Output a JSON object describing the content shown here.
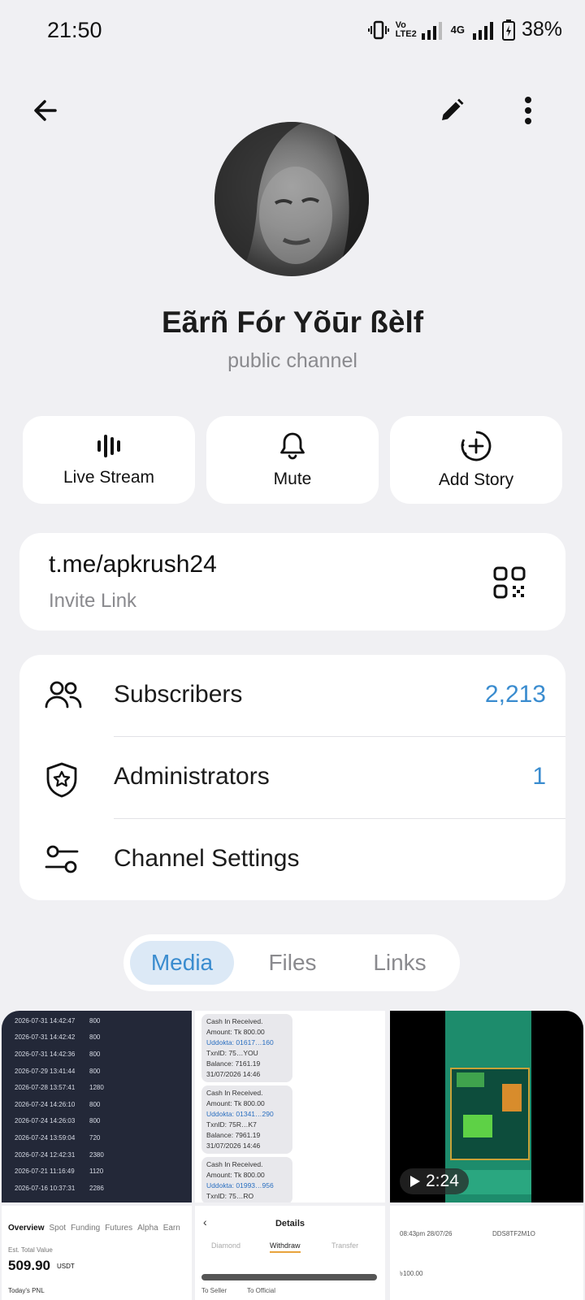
{
  "status_bar": {
    "time": "21:50",
    "battery": "38%",
    "network": "4G",
    "volte": "Vo LTE2"
  },
  "header": {
    "back_icon": "arrow-left-icon",
    "edit_icon": "pencil-icon",
    "menu_icon": "more-vertical-icon"
  },
  "profile": {
    "name": "Eãrñ Fór Yõūr ßèlf",
    "type": "public channel"
  },
  "actions": [
    {
      "label": "Live Stream",
      "icon": "live-stream-icon"
    },
    {
      "label": "Mute",
      "icon": "bell-icon"
    },
    {
      "label": "Add Story",
      "icon": "add-story-icon"
    }
  ],
  "invite": {
    "link": "t.me/apkrush24",
    "label": "Invite Link",
    "icon": "qr-code-icon"
  },
  "info_rows": [
    {
      "label": "Subscribers",
      "value": "2,213",
      "icon": "users-icon"
    },
    {
      "label": "Administrators",
      "value": "1",
      "icon": "shield-star-icon"
    },
    {
      "label": "Channel Settings",
      "value": "",
      "icon": "sliders-icon"
    }
  ],
  "tabs": [
    {
      "label": "Media",
      "active": true
    },
    {
      "label": "Files",
      "active": false
    },
    {
      "label": "Links",
      "active": false
    }
  ],
  "media": {
    "cell1_rows": [
      [
        "2026-07-31 14:42:47",
        "800"
      ],
      [
        "2026-07-31 14:42:42",
        "800"
      ],
      [
        "2026-07-31 14:42:36",
        "800"
      ],
      [
        "2026-07-29 13:41:44",
        "800"
      ],
      [
        "2026-07-28 13:57:41",
        "1280"
      ],
      [
        "2026-07-24 14:26:10",
        "800"
      ],
      [
        "2026-07-24 14:26:03",
        "800"
      ],
      [
        "2026-07-24 13:59:04",
        "720"
      ],
      [
        "2026-07-24 12:42:31",
        "2380"
      ],
      [
        "2026-07-21 11:16:49",
        "1120"
      ],
      [
        "2026-07-16 10:37:31",
        "2286"
      ]
    ],
    "cell2_msgs": [
      [
        "Cash In Received.",
        "Amount: Tk 800.00",
        "Uddokta: 01617…160",
        "TxnID: 75…YOU",
        "Balance: 7161.19",
        "31/07/2026 14:46"
      ],
      [
        "Cash In Received.",
        "Amount: Tk 800.00",
        "Uddokta: 01341…290",
        "TxnID: 75R…K7",
        "Balance: 7961.19",
        "31/07/2026 14:46"
      ],
      [
        "Cash In Received.",
        "Amount: Tk 800.00",
        "Uddokta: 01993…956",
        "TxnID: 75…RO"
      ]
    ],
    "video_duration": "2:24",
    "cell4": {
      "tabs": [
        "Overview",
        "Spot",
        "Funding",
        "Futures",
        "Alpha",
        "Earn"
      ],
      "label": "Est. Total Value",
      "value": "509.90",
      "unit": "USDT",
      "pnl_label": "Today's PNL"
    },
    "cell5": {
      "title": "Details",
      "tabs": [
        "Diamond",
        "Withdraw",
        "Transfer"
      ],
      "opt1": "To Seller",
      "opt2": "To Official"
    },
    "cell6": {
      "time": "08:43pm 28/07/26",
      "code": "DDS8TF2M1O",
      "amount": "৳100.00"
    }
  }
}
